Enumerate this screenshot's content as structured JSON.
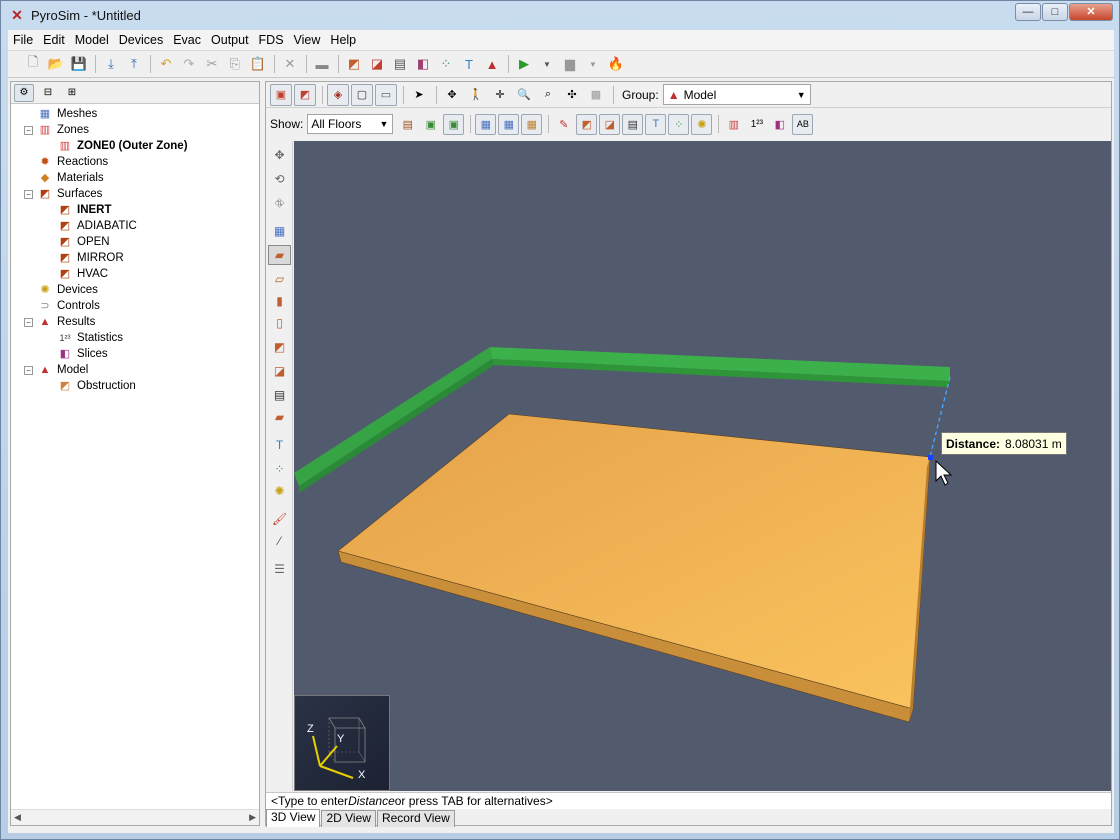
{
  "window": {
    "title": "PyroSim - *Untitled",
    "buttons": {
      "minimize": "—",
      "maximize": "□",
      "close": "✕"
    }
  },
  "menu": [
    "File",
    "Edit",
    "Model",
    "Devices",
    "Evac",
    "Output",
    "FDS",
    "View",
    "Help"
  ],
  "tree": [
    {
      "label": "Meshes",
      "icon": "mesh-icon",
      "glyph": "▦",
      "color": "#4a6fc0",
      "level": 1,
      "toggle": "",
      "bold": false
    },
    {
      "label": "Zones",
      "icon": "zone-icon",
      "glyph": "▥",
      "color": "#d04040",
      "level": 1,
      "toggle": "−",
      "bold": false
    },
    {
      "label": "ZONE0 (Outer Zone)",
      "icon": "zone-item-icon",
      "glyph": "▥",
      "color": "#d04040",
      "level": 2,
      "toggle": "",
      "bold": true
    },
    {
      "label": "Reactions",
      "icon": "reaction-icon",
      "glyph": "✹",
      "color": "#c05010",
      "level": 1,
      "toggle": "",
      "bold": false
    },
    {
      "label": "Materials",
      "icon": "material-icon",
      "glyph": "◆",
      "color": "#d08020",
      "level": 1,
      "toggle": "",
      "bold": false
    },
    {
      "label": "Surfaces",
      "icon": "surface-icon",
      "glyph": "◩",
      "color": "#b04010",
      "level": 1,
      "toggle": "−",
      "bold": false
    },
    {
      "label": "INERT",
      "icon": "surface-item-icon",
      "glyph": "◩",
      "color": "#b04010",
      "level": 2,
      "toggle": "",
      "bold": true
    },
    {
      "label": "ADIABATIC",
      "icon": "surface-item-icon",
      "glyph": "◩",
      "color": "#b04010",
      "level": 2,
      "toggle": "",
      "bold": false
    },
    {
      "label": "OPEN",
      "icon": "surface-item-icon",
      "glyph": "◩",
      "color": "#b04010",
      "level": 2,
      "toggle": "",
      "bold": false
    },
    {
      "label": "MIRROR",
      "icon": "surface-item-icon",
      "glyph": "◩",
      "color": "#b04010",
      "level": 2,
      "toggle": "",
      "bold": false
    },
    {
      "label": "HVAC",
      "icon": "surface-item-icon",
      "glyph": "◩",
      "color": "#b04010",
      "level": 2,
      "toggle": "",
      "bold": false
    },
    {
      "label": "Devices",
      "icon": "device-icon",
      "glyph": "✺",
      "color": "#c8a010",
      "level": 1,
      "toggle": "",
      "bold": false
    },
    {
      "label": "Controls",
      "icon": "control-icon",
      "glyph": "⊃",
      "color": "#888888",
      "level": 1,
      "toggle": "",
      "bold": false
    },
    {
      "label": "Results",
      "icon": "results-icon",
      "glyph": "▲",
      "color": "#c03030",
      "level": 1,
      "toggle": "−",
      "bold": false
    },
    {
      "label": "Statistics",
      "icon": "statistics-icon",
      "glyph": "1²³",
      "color": "#333333",
      "level": 2,
      "toggle": "",
      "bold": false
    },
    {
      "label": "Slices",
      "icon": "slice-icon",
      "glyph": "◧",
      "color": "#a03080",
      "level": 2,
      "toggle": "",
      "bold": false
    },
    {
      "label": "Model",
      "icon": "model-icon",
      "glyph": "▲",
      "color": "#c03030",
      "level": 1,
      "toggle": "−",
      "bold": false
    },
    {
      "label": "Obstruction",
      "icon": "obstruction-icon",
      "glyph": "◩",
      "color": "#d08040",
      "level": 2,
      "toggle": "",
      "bold": false
    }
  ],
  "view": {
    "group_label": "Group:",
    "group_value": "Model",
    "show_label": "Show:",
    "show_value": "All Floors",
    "distance_label": "Distance:",
    "distance_value": "8.08031 m",
    "axes": {
      "x": "X",
      "y": "Y",
      "z": "Z"
    },
    "command_prefix": "<Type to enter ",
    "command_em": "Distance",
    "command_suffix": " or press TAB for alternatives>",
    "tabs": [
      "3D View",
      "2D View",
      "Record View"
    ]
  },
  "colors": {
    "viewport_bg": "#525a6e",
    "slab_top": "#f2b558",
    "slab_side": "#c78f3a",
    "wall": "#3aa048",
    "measure": "#4aa8ff"
  }
}
